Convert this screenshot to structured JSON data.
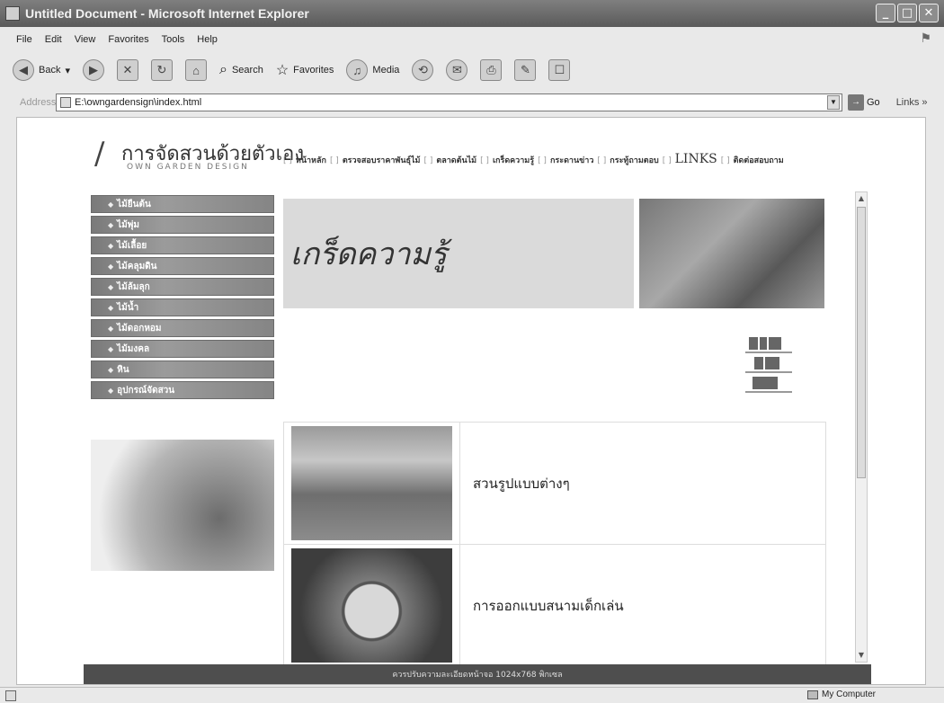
{
  "window": {
    "title": "Untitled Document - Microsoft Internet Explorer"
  },
  "menu": [
    "File",
    "Edit",
    "View",
    "Favorites",
    "Tools",
    "Help"
  ],
  "toolbar": {
    "back": "Back",
    "search": "Search",
    "favorites": "Favorites",
    "media": "Media"
  },
  "address": {
    "label": "Address",
    "url": "E:\\owngardensign\\index.html",
    "go": "Go",
    "links": "Links"
  },
  "site": {
    "brand": "การจัดสวนด้วยตัวเอง",
    "brand_sub": "OWN GARDEN DESIGN",
    "nav": [
      "หน้าหลัก",
      "ตรวจสอบราคาพันธุ์ไม้",
      "ตลาดต้นไม้",
      "เกร็ดความรู้",
      "กระดานข่าว",
      "กระทู้ถามตอบ",
      "LINKS",
      "ติดต่อสอบถาม"
    ],
    "left_menu": [
      "ไม้ยืนต้น",
      "ไม้พุ่ม",
      "ไม้เลื้อย",
      "ไม้คลุมดิน",
      "ไม้ล้มลุก",
      "ไม้น้ำ",
      "ไม้ดอกหอม",
      "ไม้มงคล",
      "หิน",
      "อุปกรณ์จัดสวน"
    ],
    "banner_title": "เกร็ดความรู้",
    "articles": [
      {
        "label": "สวนรูปแบบต่างๆ"
      },
      {
        "label": "การออกแบบสนามเด็กเล่น"
      }
    ],
    "footer": "ควรปรับความละเอียดหน้าจอ 1024x768 พิกเซล"
  },
  "status": {
    "zone": "My Computer"
  }
}
